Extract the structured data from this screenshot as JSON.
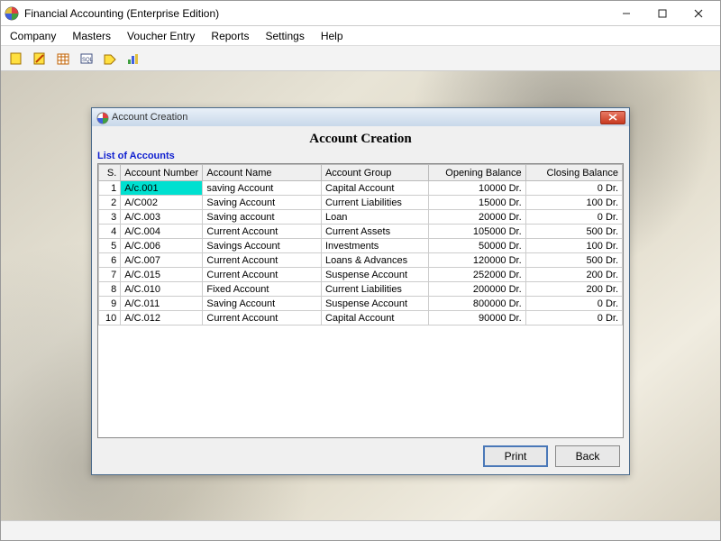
{
  "window": {
    "title": "Financial Accounting (Enterprise Edition)"
  },
  "menu": {
    "company": "Company",
    "masters": "Masters",
    "voucher": "Voucher Entry",
    "reports": "Reports",
    "settings": "Settings",
    "help": "Help"
  },
  "child": {
    "title": "Account Creation",
    "header": "Account Creation",
    "list_title": "List of Accounts"
  },
  "columns": {
    "s": "S.",
    "ac_number": "Account Number",
    "ac_name": "Account Name",
    "ac_group": "Account Group",
    "opening": "Opening Balance",
    "closing": "Closing Balance"
  },
  "rows": [
    {
      "s": "1",
      "num": "A/c.001",
      "name": "saving Account",
      "group": "Capital Account",
      "open": "10000 Dr.",
      "close": "0 Dr."
    },
    {
      "s": "2",
      "num": "A/C002",
      "name": "Saving Account",
      "group": "Current Liabilities",
      "open": "15000 Dr.",
      "close": "100 Dr."
    },
    {
      "s": "3",
      "num": "A/C.003",
      "name": "Saving account",
      "group": "Loan",
      "open": "20000 Dr.",
      "close": "0 Dr."
    },
    {
      "s": "4",
      "num": "A/C.004",
      "name": "Current Account",
      "group": "Current Assets",
      "open": "105000 Dr.",
      "close": "500 Dr."
    },
    {
      "s": "5",
      "num": "A/C.006",
      "name": "Savings Account",
      "group": "Investments",
      "open": "50000 Dr.",
      "close": "100 Dr."
    },
    {
      "s": "6",
      "num": "A/C.007",
      "name": "Current Account",
      "group": "Loans & Advances",
      "open": "120000 Dr.",
      "close": "500 Dr."
    },
    {
      "s": "7",
      "num": "A/C.015",
      "name": "Current Account",
      "group": "Suspense Account",
      "open": "252000 Dr.",
      "close": "200 Dr."
    },
    {
      "s": "8",
      "num": "A/C.010",
      "name": "Fixed Account",
      "group": "Current Liabilities",
      "open": "200000 Dr.",
      "close": "200 Dr."
    },
    {
      "s": "9",
      "num": "A/C.011",
      "name": "Saving Account",
      "group": "Suspense Account",
      "open": "800000 Dr.",
      "close": "0 Dr."
    },
    {
      "s": "10",
      "num": "A/C.012",
      "name": "Current Account",
      "group": "Capital Account",
      "open": "90000 Dr.",
      "close": "0 Dr."
    }
  ],
  "buttons": {
    "print": "Print",
    "back": "Back"
  }
}
